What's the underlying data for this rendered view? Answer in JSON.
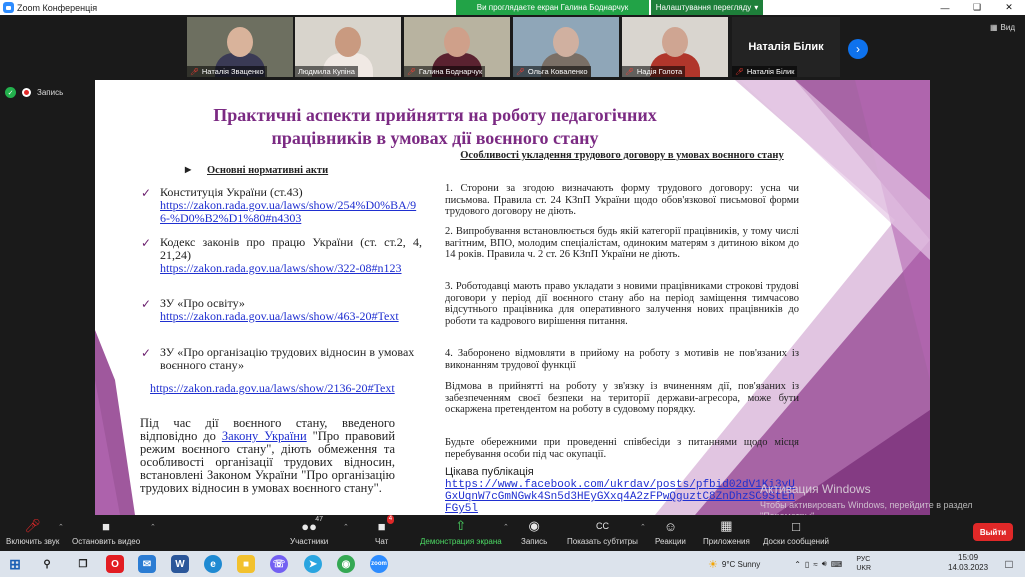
{
  "window": {
    "title": "Zoom Конференція",
    "share_banner": "Ви проглядаєте екран Галина Боднарчук",
    "view_settings": "Налаштування перегляду",
    "view_settings_caret": "▾",
    "view_mode": "Вид"
  },
  "participants": [
    {
      "name": "Наталія Зваценко",
      "muted": true,
      "bg": "#6d6f60",
      "skin": "#d9b39b",
      "cloth": "#3a3a55"
    },
    {
      "name": "Людмила Купіна",
      "muted": false,
      "bg": "#d8d4cc",
      "skin": "#c99a80",
      "cloth": "#f0e9e4",
      "active": true
    },
    {
      "name": "Галина Боднарчук",
      "muted": true,
      "bg": "#b8b3a0",
      "skin": "#cfa08a",
      "cloth": "#5a2230"
    },
    {
      "name": "Ольга Коваленко",
      "muted": true,
      "bg": "#8fa6b8",
      "skin": "#d0b0a0",
      "cloth": "#7a6f66"
    },
    {
      "name": "Надія Голота",
      "muted": true,
      "bg": "#d9d5cf",
      "skin": "#cfa592",
      "cloth": "#b0362b"
    }
  ],
  "big_tile": {
    "name": "Наталія Білик",
    "label": "Наталія Білик"
  },
  "recording": {
    "label": "Запись"
  },
  "slide": {
    "title_line1": "Практичні аспекти прийняття на роботу педагогічних",
    "title_line2": "працівників в умовах дії воєнного стану",
    "left_heading": "Основні нормативні акти",
    "acts": [
      {
        "text": "Конституція      України      (ст.43)",
        "link": "https://zakon.rada.gov.ua/laws/show/254%D0%BA/96-%D0%B2%D1%80#n4303"
      },
      {
        "text": "Кодекс законів про працю України (ст. ст.2, 4,                                    21,24)",
        "link": "https://zakon.rada.gov.ua/laws/show/322-08#n123"
      },
      {
        "text": "ЗУ             «Про            освіту»",
        "link": "https://zakon.rada.gov.ua/laws/show/463-20#Text"
      },
      {
        "text": "ЗУ «Про організацію трудових відносин в умовах воєнного стану»",
        "link": ""
      }
    ],
    "extra_link": "https://zakon.rada.gov.ua/laws/show/2136-20#Text",
    "para_before": "Під час дії воєнного стану, введеного відповідно до",
    "para_link": "Закону України",
    "para_after": "\"Про правовий режим воєнного стану\", діють обмеження та особливості організації трудових відносин, встановлені Законом України \"Про організацію трудових відносин в умовах воєнного стану\".",
    "right_heading": "Особливості укладення трудового договору в умовах воєнного стану",
    "points": [
      "1. Сторони за згодою визначають форму трудового договору: усна чи письмова. Правила ст. 24 КЗпП України щодо обов'язкової письмової форми трудового договору не діють.",
      "2. Випробування встановлюється будь якій категорії працівників, у тому числі вагітним, ВПО, молодим спеціалістам, одиноким матерям з дитиною віком до 14 років. Правила ч. 2 ст. 26 КЗпП України не діють.",
      "3. Роботодавці мають право укладати з новими працівниками строкові трудові договори у період дії воєнного стану або на період заміщення тимчасово відсутнього працівника для оперативного залучення нових працівників до роботи та кадрового вирішення питання.",
      "4. Заборонено відмовляти в прийому на роботу з мотивів не пов'язаних із виконанням трудової функції",
      "Відмова в прийнятті на роботу у зв'язку із вчиненням дії, пов'язаних із забезпеченням своєї безпеки на території держави-агресора, може бути оскаржена претендентом на роботу в судовому порядку.",
      "Будьте обережними при проведенні співбесіди з питаннями щодо місця перебування особи під час окупації."
    ],
    "pub_label": "Цікава                                  публікація",
    "fb_link": "https://www.facebook.com/ukrdav/posts/pfbid02dV1Ki3yUGxUqnW7cGmNGwk4Sn5d3HEyGXxq4A2zFPwQguztC8ZnDhzSC9StEhFGy5l"
  },
  "watermark": {
    "line1": "Активация Windows",
    "line2": "Чтобы активировать Windows, перейдите в раздел \"Параметры\"."
  },
  "toolbar": {
    "mute": "Включить звук",
    "video": "Остановить видео",
    "participants": "Участники",
    "participants_count": "47",
    "chat": "Чат",
    "chat_badge": "4",
    "share": "Демонстрация экрана",
    "record": "Запись",
    "subtitles": "Показать субтитры",
    "reactions": "Реакции",
    "apps": "Приложения",
    "whiteboard": "Доски сообщений",
    "leave": "Выйти"
  },
  "taskbar": {
    "weather": "9°C  Sunny",
    "lang1": "РУС",
    "lang2": "UKR",
    "time": "15:09",
    "date": "14.03.2023"
  }
}
